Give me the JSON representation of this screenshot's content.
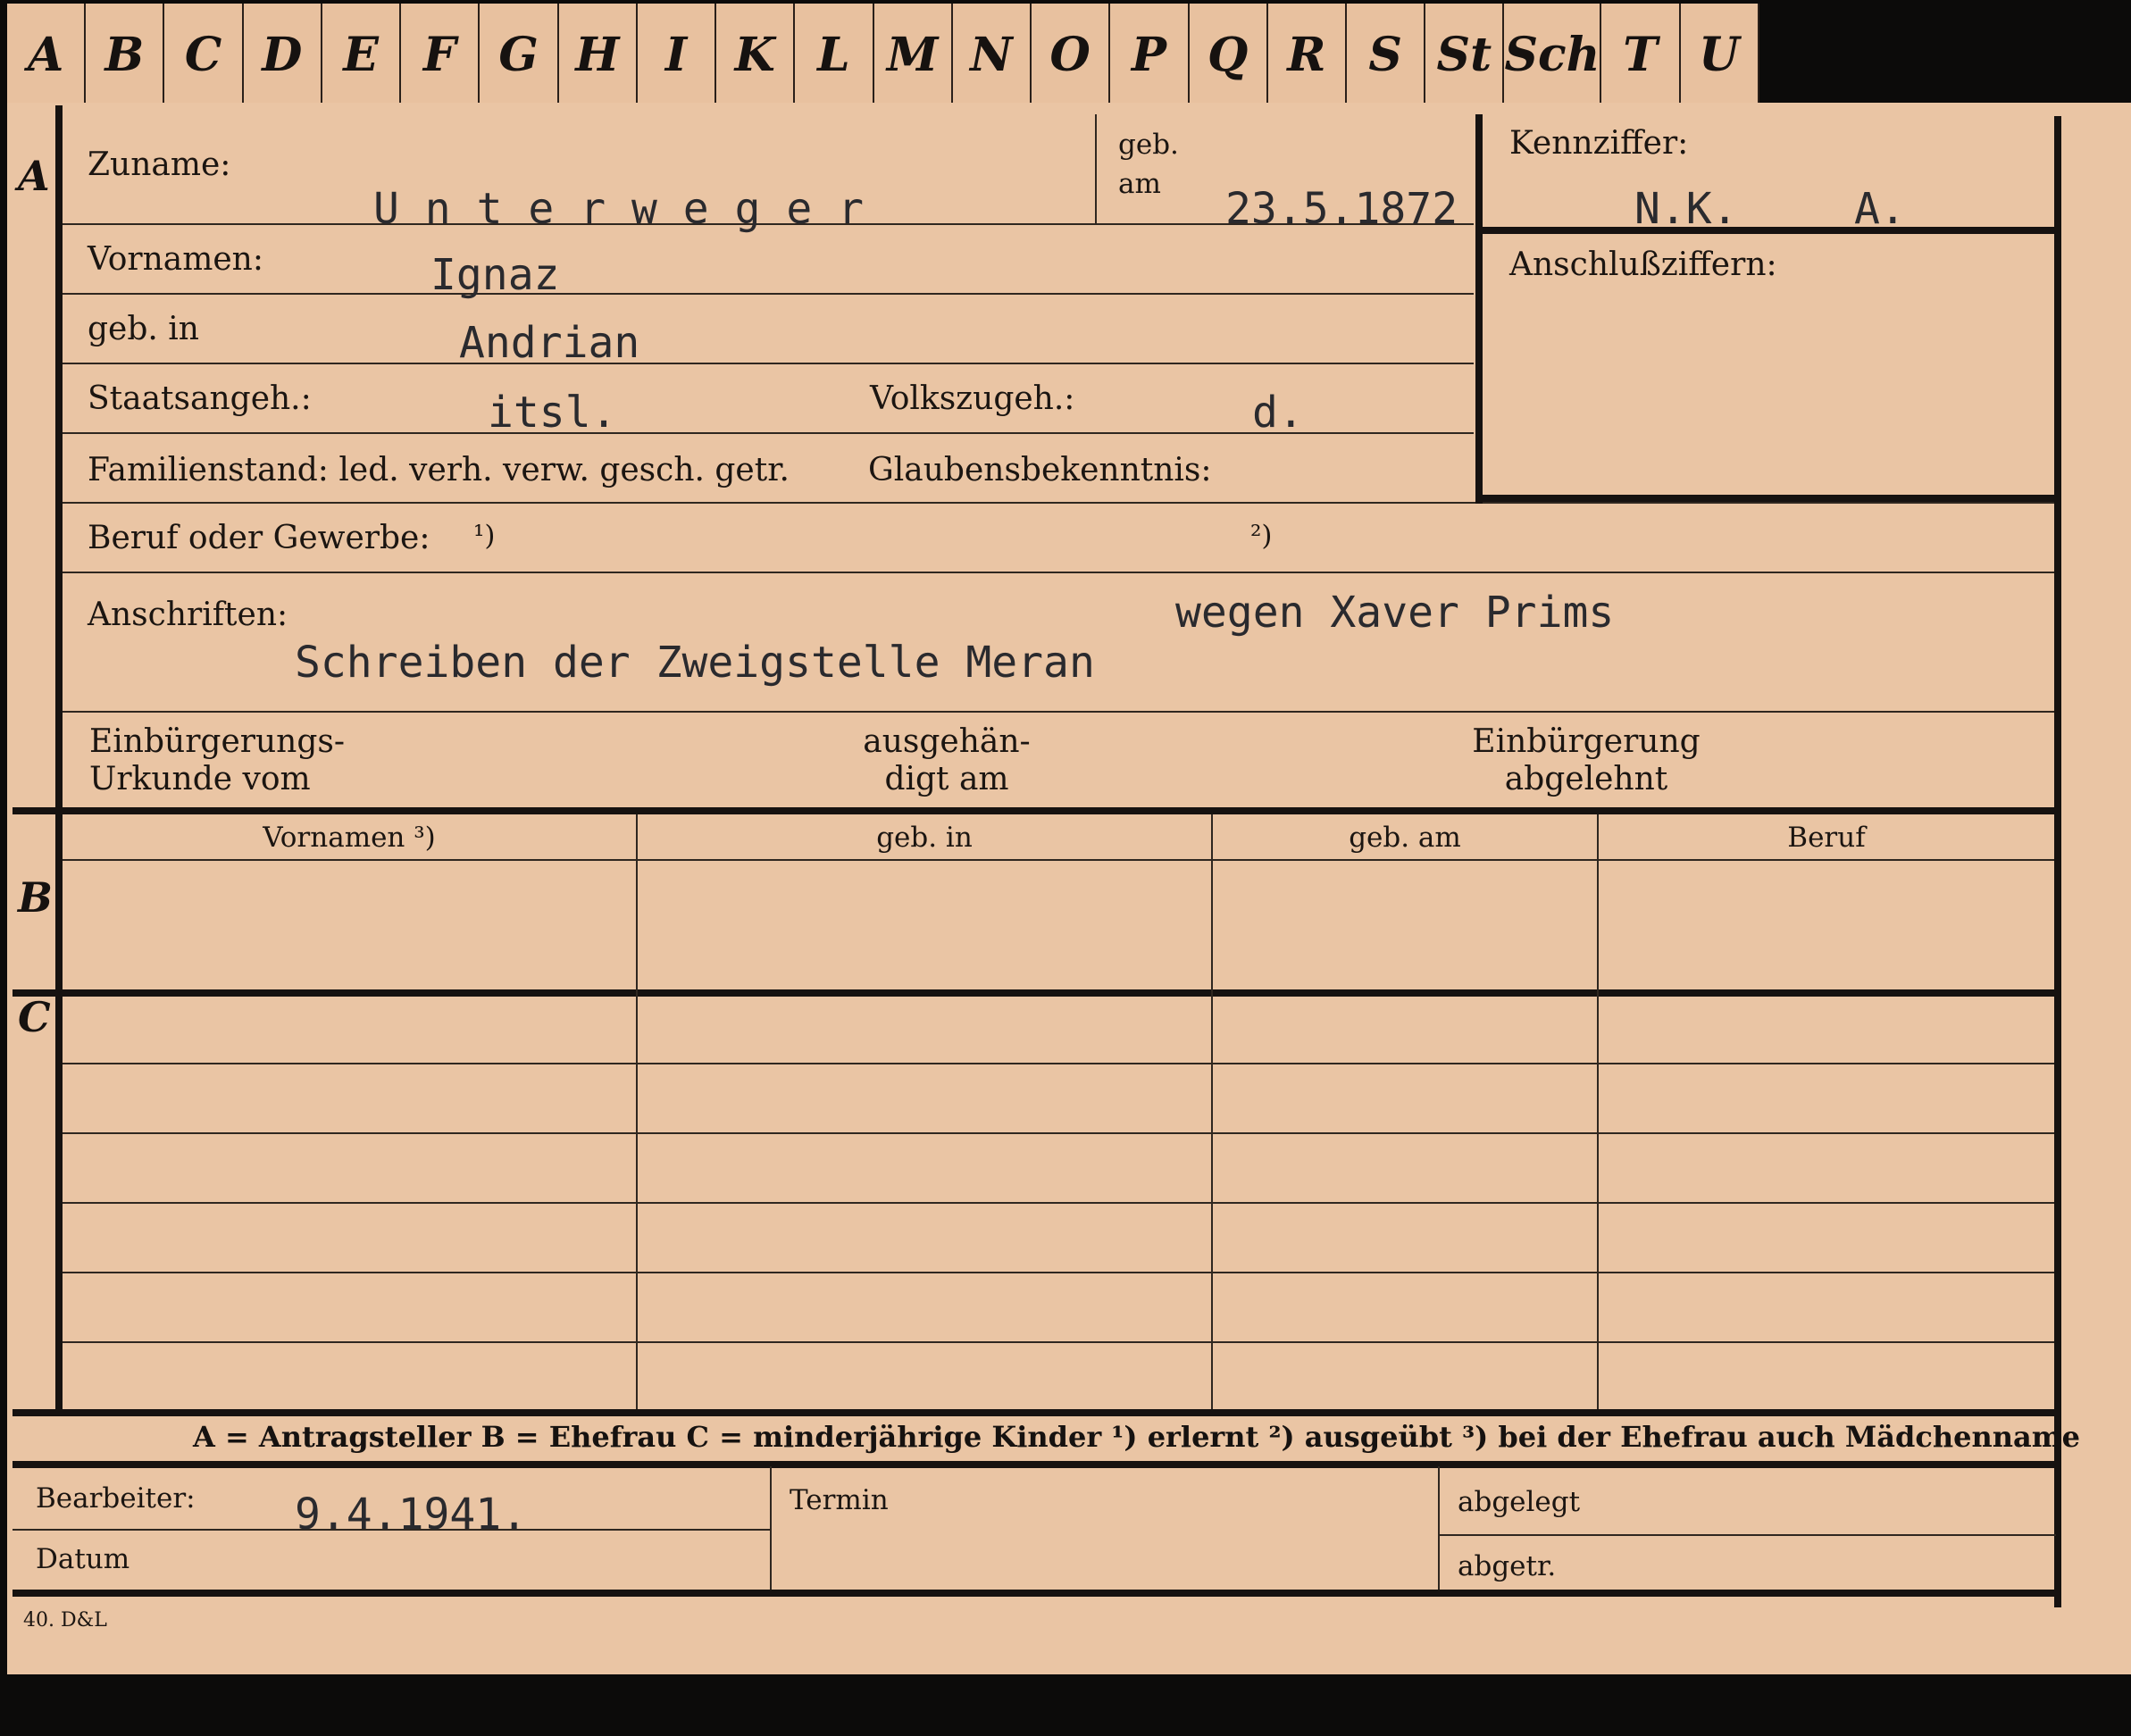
{
  "tabs": [
    "A",
    "B",
    "C",
    "D",
    "E",
    "F",
    "G",
    "H",
    "I",
    "K",
    "L",
    "M",
    "N",
    "O",
    "P",
    "Q",
    "R",
    "S",
    "St",
    "Sch",
    "T",
    "U"
  ],
  "section_letters": {
    "a": "A",
    "b": "B",
    "c": "C"
  },
  "labels": {
    "zuname": "Zuname:",
    "geb_am": "geb.\nam",
    "vornamen": "Vornamen:",
    "geb_in": "geb. in",
    "staatsangeh": "Staatsangeh.:",
    "volkszugeh": "Volkszugeh.:",
    "familienstand": "Familienstand: led. verh. verw. gesch. getr.",
    "glaubensbekenntnis": "Glaubensbekenntnis:",
    "beruf": "Beruf oder Gewerbe:",
    "fn1": "¹)",
    "fn2": "²)",
    "anschriften": "Anschriften:",
    "einbuergerungs_urkunde": "Einbürgerungs-\nUrkunde vom",
    "ausgehaendigt": "ausgehän-\ndigt am",
    "einbuergerung_abgelehnt": "Einbürgerung\nabgelehnt",
    "kennziffer": "Kennziffer:",
    "anschlussziffern": "Anschlußziffern:",
    "bearbeiter": "Bearbeiter:",
    "datum": "Datum",
    "termin": "Termin",
    "abgelegt": "abgelegt",
    "abgetr": "abgetr.",
    "printer": "40. D&L"
  },
  "table_headers": [
    "Vornamen ³)",
    "geb. in",
    "geb. am",
    "Beruf"
  ],
  "legend": "A = Antragsteller   B = Ehefrau   C = minderjährige Kinder   ¹) erlernt   ²) ausgeübt   ³) bei der Ehefrau auch Mädchenname",
  "values": {
    "zuname": "U n t e r w e g e r",
    "geb_am": "23.5.1872",
    "vornamen": "Ignaz",
    "geb_in": "Andrian",
    "staatsangeh": "itsl.",
    "volkszugeh": "d.",
    "kennziffer_1": "N.K.",
    "kennziffer_2": "A.",
    "anschriften_1": "wegen Xaver Prims",
    "anschriften_2": "Schreiben der Zweigstelle Meran",
    "bearbeiter_date": "9.4.1941."
  }
}
